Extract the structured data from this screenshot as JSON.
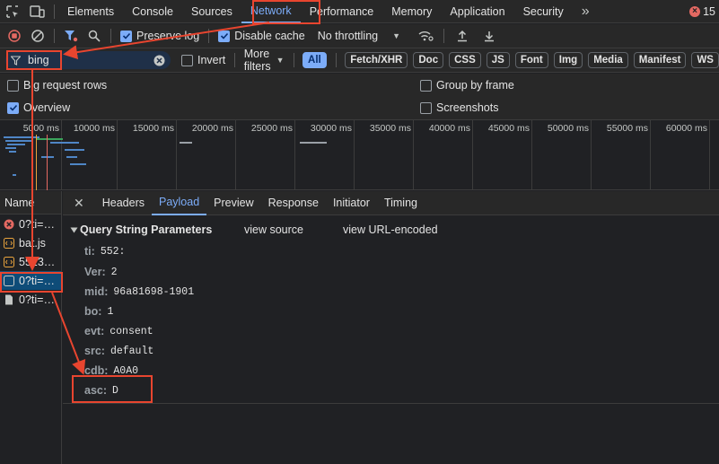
{
  "tabbar": {
    "tabs": [
      {
        "label": "Elements"
      },
      {
        "label": "Console"
      },
      {
        "label": "Sources"
      },
      {
        "label": "Network"
      },
      {
        "label": "Performance"
      },
      {
        "label": "Memory"
      },
      {
        "label": "Application"
      },
      {
        "label": "Security"
      }
    ],
    "more_label": "»",
    "error_count": "15",
    "error_symbol": "×"
  },
  "toolbar": {
    "preserve_log_label": "Preserve log",
    "disable_cache_label": "Disable cache",
    "throttling_value": "No throttling",
    "dropdown_arrow": "▼"
  },
  "filterbar": {
    "filter_value": "bing",
    "invert_label": "Invert",
    "more_filters_label": "More filters",
    "type_pills": [
      "All",
      "Fetch/XHR",
      "Doc",
      "CSS",
      "JS",
      "Font",
      "Img",
      "Media",
      "Manifest",
      "WS"
    ]
  },
  "settings": {
    "big_rows_label": "Big request rows",
    "overview_label": "Overview",
    "group_by_frame_label": "Group by frame",
    "screenshots_label": "Screenshots"
  },
  "timeline": {
    "ticks": [
      "5000 ms",
      "10000 ms",
      "15000 ms",
      "20000 ms",
      "25000 ms",
      "30000 ms",
      "35000 ms",
      "40000 ms",
      "45000 ms",
      "50000 ms",
      "55000 ms",
      "60000 ms"
    ]
  },
  "request_list": {
    "header": "Name",
    "rows": [
      {
        "name": "0?ti=…",
        "icon": "error-icon"
      },
      {
        "name": "bat.js",
        "icon": "script-icon"
      },
      {
        "name": "5523…",
        "icon": "script-icon"
      },
      {
        "name": "0?ti=…",
        "icon": "request-icon"
      },
      {
        "name": "0?ti=…",
        "icon": "document-icon"
      }
    ]
  },
  "details": {
    "close_symbol": "✕",
    "tabs": [
      "Headers",
      "Payload",
      "Preview",
      "Response",
      "Initiator",
      "Timing"
    ],
    "section_title": "Query String Parameters",
    "view_source_label": "view source",
    "view_url_encoded_label": "view URL-encoded",
    "params": [
      {
        "key": "ti:",
        "value": "552:"
      },
      {
        "key": "Ver:",
        "value": "2"
      },
      {
        "key": "mid:",
        "value": "96a81698-1901"
      },
      {
        "key": "bo:",
        "value": "1"
      },
      {
        "key": "evt:",
        "value": "consent"
      },
      {
        "key": "src:",
        "value": "default"
      },
      {
        "key": "cdb:",
        "value": "A0A0"
      },
      {
        "key": "asc:",
        "value": "D"
      }
    ]
  },
  "colors": {
    "accent": "#7cacf8",
    "annotation": "#e8452f",
    "error": "#e46962",
    "selected_row": "#0e4c78"
  }
}
